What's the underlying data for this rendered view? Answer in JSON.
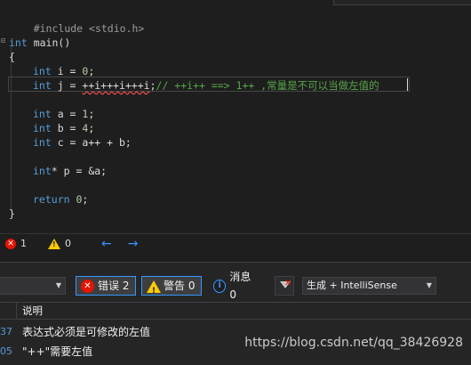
{
  "editor": {
    "lines": {
      "include": "#include <stdio.h>",
      "main_kw": "int",
      "main_rest": " main()",
      "brace_open": "{",
      "l1_kw": "int",
      "l1_rest": " i = ",
      "l1_num": "0",
      "l1_end": ";",
      "l2_kw": "int",
      "l2_pre": " j = ",
      "l2_err": "++i+++i+++i",
      "l2_semi": ";",
      "l2_comment": "// ++i++ ==> 1++ ,常量是不可以当做左值的",
      "l3_kw": "int",
      "l3_rest": " a = ",
      "l3_num": "1",
      "l3_end": ";",
      "l4_kw": "int",
      "l4_rest": " b = ",
      "l4_num": "4",
      "l4_end": ";",
      "l5_kw": "int",
      "l5_rest": " c = a++ + b;",
      "l6_kw": "int",
      "l6_rest": "* p = &a;",
      "ret_kw": "return",
      "ret_rest": " ",
      "ret_num": "0",
      "ret_end": ";",
      "brace_close": "}"
    }
  },
  "editor_status": {
    "errors": "1",
    "warnings": "0",
    "back_arrow": "←",
    "forward_arrow": "→"
  },
  "error_list": {
    "scope_combo": "",
    "errors_btn": "错误 2",
    "warnings_btn": "警告 0",
    "messages_btn": "消息 0",
    "source_combo": "生成 + IntelliSense",
    "column_description": "说明",
    "rows": [
      {
        "code": "37",
        "description": "表达式必须是可修改的左值"
      },
      {
        "code": "05",
        "description": "\"++\"需要左值"
      }
    ]
  },
  "watermark": "https://blog.csdn.net/qq_38426928",
  "icons": [
    "error-icon",
    "warning-icon",
    "info-icon",
    "filter-clear-icon",
    "back-arrow-icon",
    "forward-arrow-icon"
  ],
  "colors": {
    "keyword": "#569cd6",
    "comment": "#57a64a",
    "error": "#e51400",
    "warning": "#ffcc00",
    "accent": "#3399ff"
  }
}
